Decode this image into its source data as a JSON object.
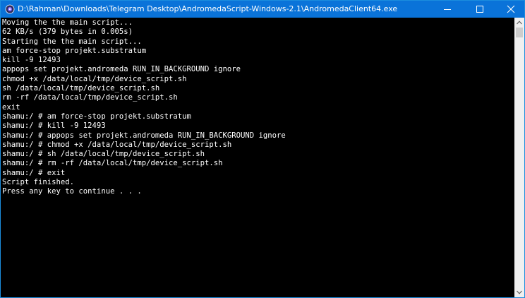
{
  "window": {
    "title": "D:\\Rahman\\Downloads\\Telegram Desktop\\AndromedaScript-Windows-2.1\\AndromedaClient64.exe",
    "app_icon": "andromeda-app-icon",
    "controls": {
      "minimize_icon": "minimize-icon",
      "maximize_icon": "maximize-icon",
      "close_icon": "close-icon"
    }
  },
  "colors": {
    "titlebar": "#0a73d9",
    "console_bg": "#000000",
    "console_text": "#ffffff"
  },
  "console": {
    "lines": [
      "Moving the the main script...",
      "62 KB/s (379 bytes in 0.005s)",
      "Starting the the main script...",
      "am force-stop projekt.substratum",
      "kill -9 12493",
      "appops set projekt.andromeda RUN_IN_BACKGROUND ignore",
      "chmod +x /data/local/tmp/device_script.sh",
      "sh /data/local/tmp/device_script.sh",
      "rm -rf /data/local/tmp/device_script.sh",
      "exit",
      "shamu:/ # am force-stop projekt.substratum",
      "shamu:/ # kill -9 12493",
      "shamu:/ # appops set projekt.andromeda RUN_IN_BACKGROUND ignore",
      "shamu:/ # chmod +x /data/local/tmp/device_script.sh",
      "shamu:/ # sh /data/local/tmp/device_script.sh",
      "shamu:/ # rm -rf /data/local/tmp/device_script.sh",
      "shamu:/ # exit",
      "Script finished.",
      "Press any key to continue . . ."
    ]
  },
  "scrollbar": {
    "up_icon": "scroll-up-arrow-icon",
    "down_icon": "scroll-down-arrow-icon"
  }
}
